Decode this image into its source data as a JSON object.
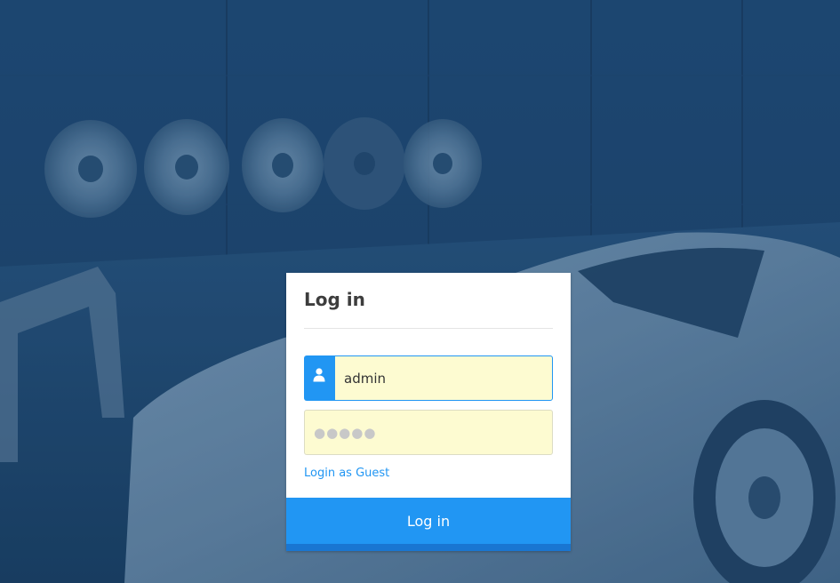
{
  "background": {
    "description_icon": "garage-showroom-background",
    "tint_color": "#1f4a72"
  },
  "login": {
    "title": "Log in",
    "username_value": "admin",
    "password_mask": "●●●●●",
    "guest_link": "Login as Guest",
    "submit_label": "Log in",
    "user_icon": "user-icon"
  },
  "colors": {
    "accent": "#2196f3",
    "input_bg": "#fdfbd1",
    "title": "#3d3d3d"
  }
}
